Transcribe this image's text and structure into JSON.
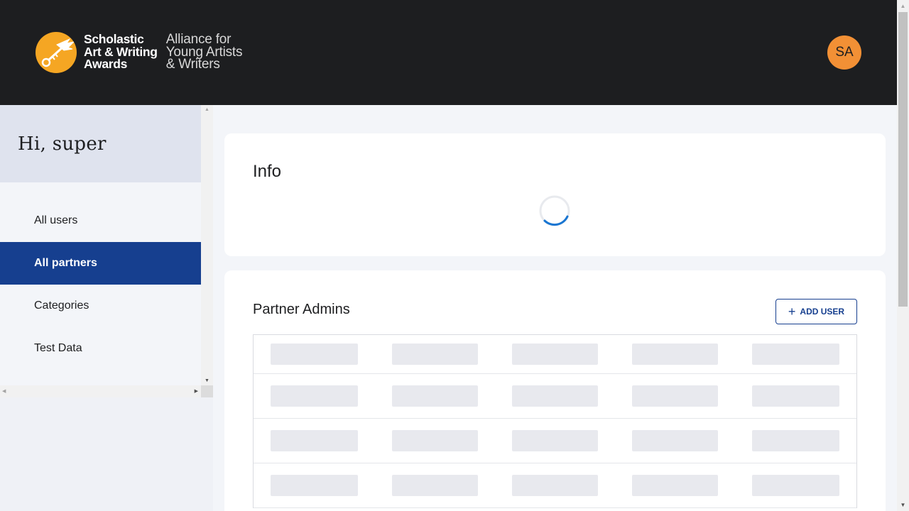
{
  "header": {
    "logo_main": [
      "Scholastic",
      "Art & Writing",
      "Awards"
    ],
    "logo_sub": [
      "Alliance for",
      "Young Artists",
      "& Writers"
    ],
    "avatar_initials": "SA"
  },
  "sidebar": {
    "greeting": "Hi, super",
    "items": [
      {
        "label": "All users",
        "active": false
      },
      {
        "label": "All partners",
        "active": true
      },
      {
        "label": "Categories",
        "active": false
      },
      {
        "label": "Test Data",
        "active": false
      }
    ]
  },
  "info_card": {
    "title": "Info",
    "loading": true
  },
  "admins_card": {
    "title": "Partner Admins",
    "add_user_label": "ADD USER",
    "skeleton_rows": 4,
    "skeleton_columns": 5
  },
  "colors": {
    "header_bg": "#1d1e20",
    "accent_orange": "#f5a623",
    "avatar_bg": "#f29035",
    "nav_active_bg": "#163f8f",
    "spinner_blue": "#1976d2"
  }
}
